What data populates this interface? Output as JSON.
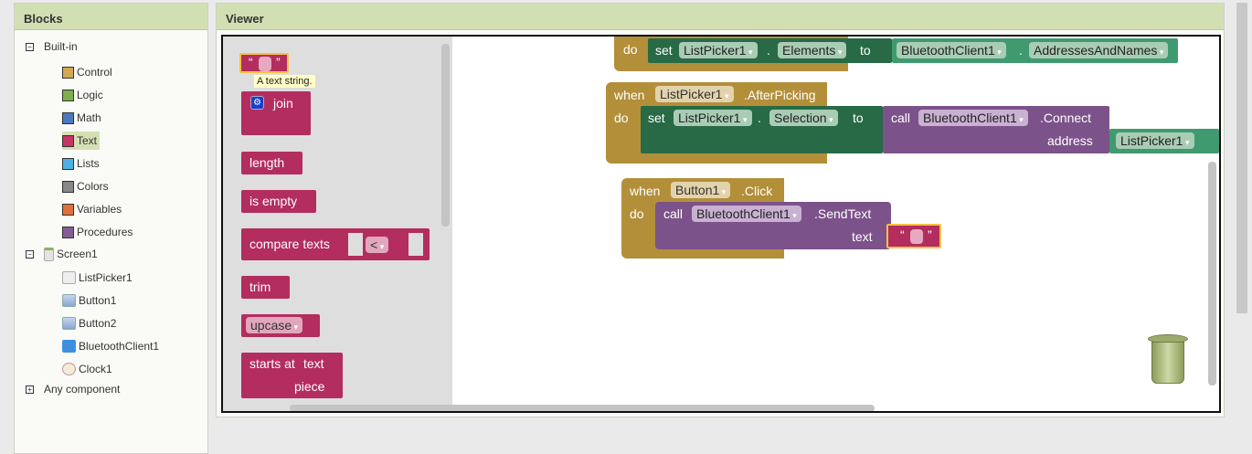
{
  "blocks_panel": {
    "title": "Blocks",
    "builtin": {
      "label": "Built-in",
      "items": [
        {
          "label": "Control",
          "color": "#d2a852"
        },
        {
          "label": "Logic",
          "color": "#7fae4c"
        },
        {
          "label": "Math",
          "color": "#4a79c0"
        },
        {
          "label": "Text",
          "color": "#c53665"
        },
        {
          "label": "Lists",
          "color": "#4fb0e3"
        },
        {
          "label": "Colors",
          "color": "#888888"
        },
        {
          "label": "Variables",
          "color": "#e0703a"
        },
        {
          "label": "Procedures",
          "color": "#875d98"
        }
      ]
    },
    "screen": {
      "label": "Screen1",
      "items": [
        "ListPicker1",
        "Button1",
        "Button2",
        "BluetoothClient1",
        "Clock1"
      ]
    },
    "any_component": "Any component"
  },
  "viewer": {
    "title": "Viewer"
  },
  "flyout": {
    "tooltip": "A text string.",
    "open_quote": "“",
    "close_quote": "”",
    "join": "join",
    "length": "length",
    "is_empty": "is empty",
    "compare": "compare texts",
    "compare_op": "<",
    "trim": "trim",
    "upcase": "upcase",
    "starts_at": "starts at",
    "text": "text",
    "piece": "piece"
  },
  "workspace": {
    "b1": {
      "do": "do",
      "set": "set",
      "comp": "ListPicker1",
      "prop": "Elements",
      "to": "to",
      "src": "BluetoothClient1",
      "srcprop": "AddressesAndNames",
      "dot": "."
    },
    "b2": {
      "when": "when",
      "comp": "ListPicker1",
      "event": ".AfterPicking",
      "do": "do",
      "set": "set",
      "prop": "Selection",
      "to": "to",
      "call": "call",
      "bt": "BluetoothClient1",
      "method": ".Connect",
      "address": "address",
      "arg": "ListPicker1",
      "dot": "."
    },
    "b3": {
      "when": "when",
      "comp": "Button1",
      "event": ".Click",
      "do": "do",
      "call": "call",
      "bt": "BluetoothClient1",
      "method": ".SendText",
      "text": "text"
    }
  }
}
